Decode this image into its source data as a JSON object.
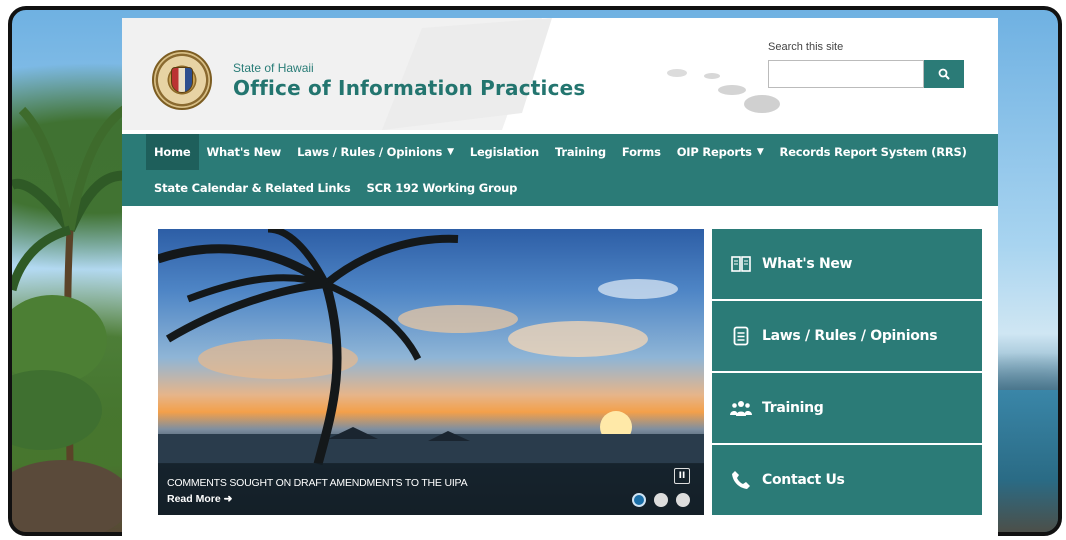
{
  "header": {
    "state_name": "State of Hawaii",
    "office_name": "Office of Information Practices",
    "search_label": "Search this site",
    "search_value": "",
    "search_button_icon": "search-icon"
  },
  "nav": {
    "row1": [
      {
        "label": "Home",
        "active": true
      },
      {
        "label": "What's New"
      },
      {
        "label": "Laws / Rules / Opinions",
        "dropdown": true
      },
      {
        "label": "Legislation"
      },
      {
        "label": "Training"
      },
      {
        "label": "Forms"
      },
      {
        "label": "OIP Reports",
        "dropdown": true
      },
      {
        "label": "Records Report System (RRS)"
      }
    ],
    "row2": [
      {
        "label": "State Calendar & Related Links"
      },
      {
        "label": "SCR 192 Working Group"
      }
    ],
    "dropdown_glyph": "▼"
  },
  "hero": {
    "caption": "COMMENTS SOUGHT ON DRAFT AMENDMENTS TO THE UIPA",
    "read_more": "Read More ➜",
    "pause_glyph": "II",
    "slides": 3,
    "active_slide": 1
  },
  "panels": [
    {
      "label": "What's New",
      "icon": "book-icon"
    },
    {
      "label": "Laws / Rules / Opinions",
      "icon": "document-icon"
    },
    {
      "label": "Training",
      "icon": "group-icon"
    },
    {
      "label": "Contact Us",
      "icon": "phone-icon"
    }
  ],
  "colors": {
    "teal": "#2b7b77",
    "teal_dark": "#1e5f5b",
    "title_teal": "#23756f"
  }
}
